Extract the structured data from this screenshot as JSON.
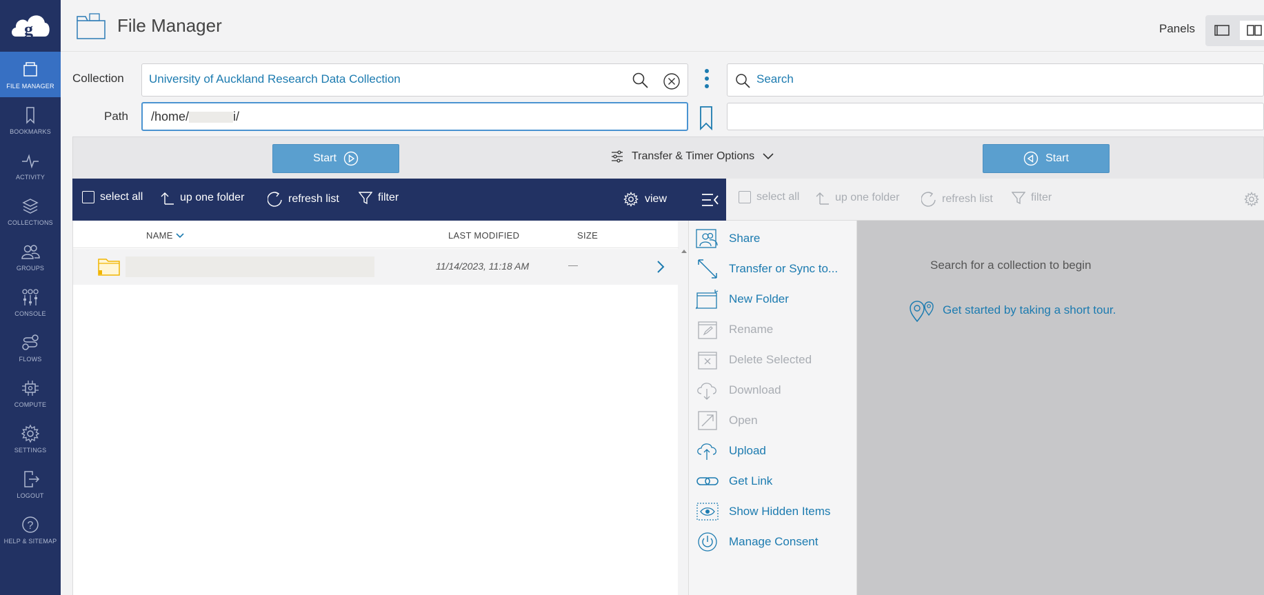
{
  "sidebar": {
    "items": [
      {
        "label": "FILE MANAGER",
        "icon": "file-manager-icon"
      },
      {
        "label": "BOOKMARKS",
        "icon": "bookmark-icon"
      },
      {
        "label": "ACTIVITY",
        "icon": "activity-icon"
      },
      {
        "label": "COLLECTIONS",
        "icon": "collections-icon"
      },
      {
        "label": "GROUPS",
        "icon": "groups-icon"
      },
      {
        "label": "CONSOLE",
        "icon": "console-icon"
      },
      {
        "label": "FLOWS",
        "icon": "flows-icon"
      },
      {
        "label": "COMPUTE",
        "icon": "compute-icon"
      },
      {
        "label": "SETTINGS",
        "icon": "gear-icon"
      },
      {
        "label": "LOGOUT",
        "icon": "logout-icon"
      },
      {
        "label": "HELP & SITEMAP",
        "icon": "help-icon"
      }
    ]
  },
  "header": {
    "title": "File Manager",
    "panels_label": "Panels"
  },
  "form": {
    "collection_label": "Collection",
    "collection_value": "University of Auckland Research Data Collection",
    "path_label": "Path",
    "path_prefix": "/home/",
    "path_suffix": "i/",
    "search_placeholder": "Search"
  },
  "transfer": {
    "start_left": "Start",
    "start_right": "Start",
    "options_label": "Transfer & Timer Options"
  },
  "toolbar": {
    "select_all": "select all",
    "up_one_folder": "up one folder",
    "refresh_list": "refresh list",
    "filter": "filter",
    "view": "view"
  },
  "list": {
    "columns": {
      "name": "NAME",
      "last_modified": "LAST MODIFIED",
      "size": "SIZE"
    },
    "rows": [
      {
        "last_modified": "11/14/2023, 11:18 AM",
        "size": "—"
      }
    ]
  },
  "actions": [
    {
      "label": "Share",
      "enabled": true
    },
    {
      "label": "Transfer or Sync to...",
      "enabled": true
    },
    {
      "label": "New Folder",
      "enabled": true
    },
    {
      "label": "Rename",
      "enabled": false
    },
    {
      "label": "Delete Selected",
      "enabled": false
    },
    {
      "label": "Download",
      "enabled": false
    },
    {
      "label": "Open",
      "enabled": false
    },
    {
      "label": "Upload",
      "enabled": true
    },
    {
      "label": "Get Link",
      "enabled": true
    },
    {
      "label": "Show Hidden Items",
      "enabled": true
    },
    {
      "label": "Manage Consent",
      "enabled": true
    }
  ],
  "right_panel": {
    "empty_text": "Search for a collection to begin",
    "tour_link": "Get started by taking a short tour."
  },
  "colors": {
    "sidebar": "#223263",
    "active_nav": "#3770c3",
    "link": "#1c7bb0",
    "start_button": "#5a9fcf"
  }
}
